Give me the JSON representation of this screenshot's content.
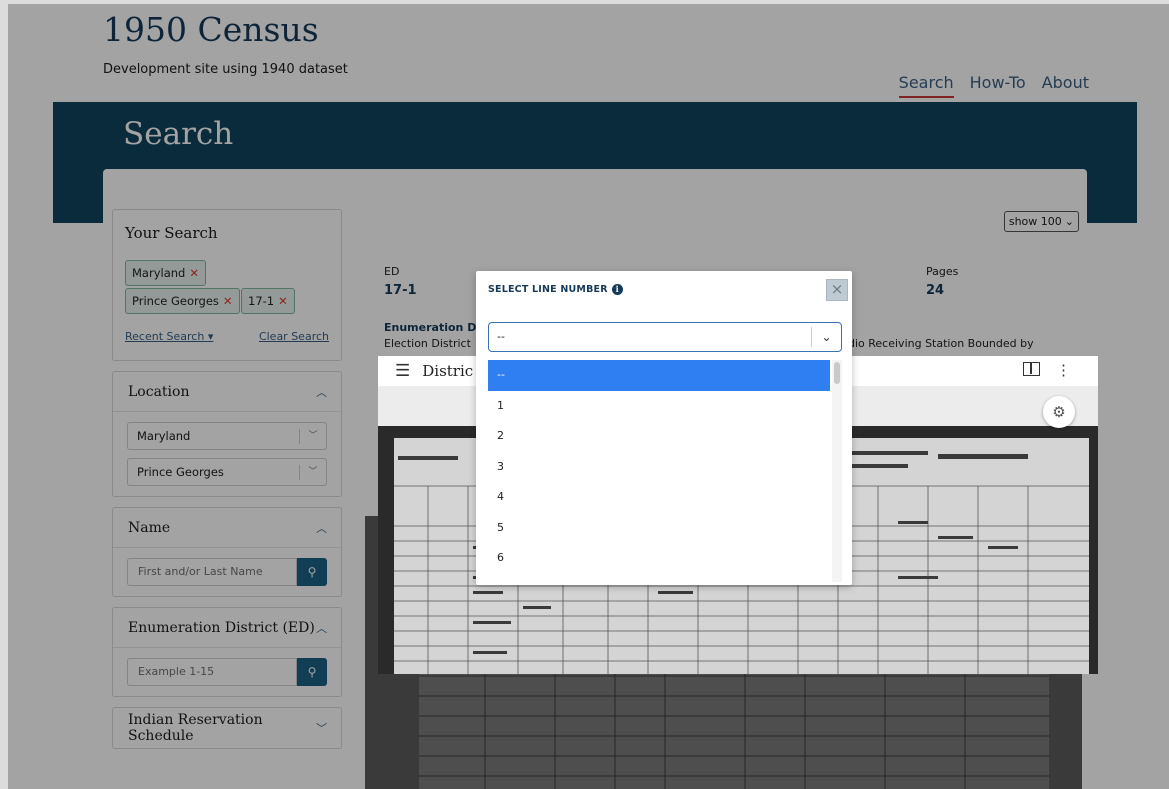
{
  "site": {
    "title": "1950 Census",
    "subtitle": "Development site using 1940 dataset",
    "nav": [
      "Search",
      "How-To",
      "About"
    ]
  },
  "banner": {
    "title": "Search"
  },
  "show": {
    "label": "show 100"
  },
  "your_search": {
    "heading": "Your Search",
    "chips": [
      "Maryland",
      "Prince Georges",
      "17-1"
    ],
    "recent": "Recent Search",
    "clear": "Clear Search"
  },
  "location": {
    "heading": "Location",
    "state": "Maryland",
    "county": "Prince Georges"
  },
  "name": {
    "heading": "Name",
    "placeholder": "First and/or Last Name"
  },
  "ed_filter": {
    "heading": "Enumeration District (ED)",
    "placeholder": "Example 1-15"
  },
  "indian": {
    "heading": "Indian Reservation Schedule"
  },
  "ed_info": {
    "ed_label": "ED",
    "ed_value": "17-1",
    "pages_label": "Pages",
    "pages_value": "24",
    "desc_heading": "Enumeration Di",
    "desc_left": "Election District",
    "desc_right": "dio Receiving Station Bounded by"
  },
  "viewer": {
    "title": "Distric"
  },
  "modal": {
    "heading": "SELECT LINE NUMBER",
    "selected": "--",
    "options": [
      "--",
      "1",
      "2",
      "3",
      "4",
      "5",
      "6"
    ]
  }
}
